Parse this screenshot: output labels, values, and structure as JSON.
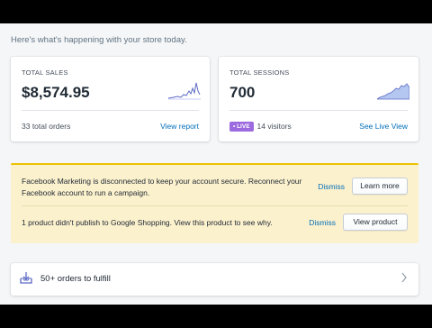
{
  "greeting": "Here's what's happening with your store today.",
  "sales": {
    "label": "TOTAL SALES",
    "value": "$8,574.95",
    "footer": "33 total orders",
    "link": "View report",
    "sparkline_color": "#5c6ac4"
  },
  "sessions": {
    "label": "TOTAL SESSIONS",
    "value": "700",
    "live_badge": "• LIVE",
    "visitors": "14 visitors",
    "link": "See Live View",
    "live_color": "#9c6ade"
  },
  "banner": {
    "facebook_message": "Facebook Marketing is disconnected to keep your account secure. Reconnect your Facebook account to run a campaign.",
    "facebook_dismiss": "Dismiss",
    "facebook_action": "Learn more",
    "google_message": "1 product didn't publish to Google Shopping. View this product to see why.",
    "google_dismiss": "Dismiss",
    "google_action": "View product",
    "accent_color": "#eec200"
  },
  "orders": {
    "label": "50+ orders to fulfill",
    "icon": "download-tray-icon"
  }
}
